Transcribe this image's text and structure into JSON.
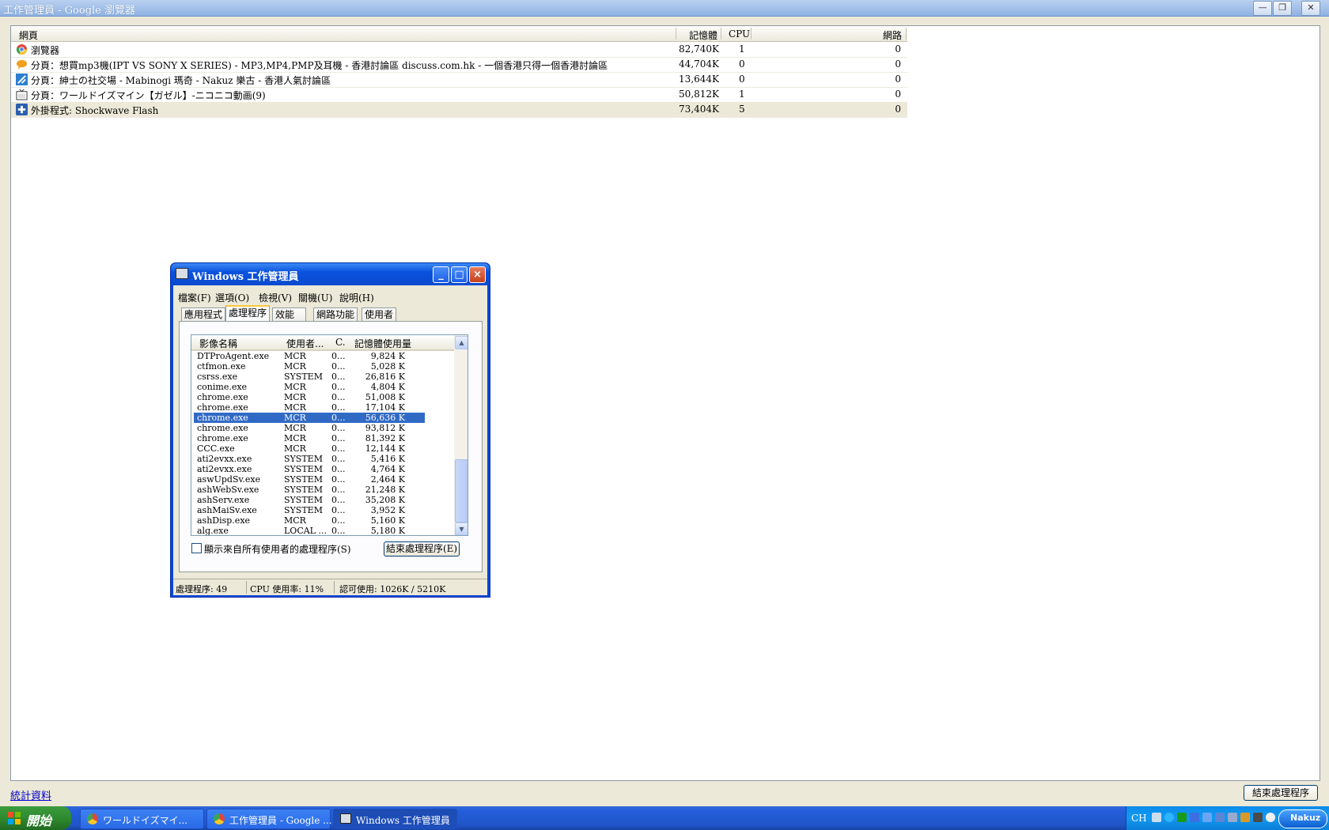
{
  "window": {
    "title": "工作管理員 - Google 瀏覽器",
    "buttons": {
      "minimize": "—",
      "restore": "❐",
      "close": "✕"
    }
  },
  "chrome_tm": {
    "columns": {
      "page": "網頁",
      "memory": "記憶體",
      "cpu": "CPU",
      "network": "網路"
    },
    "rows": [
      {
        "icon": "chrome-icon",
        "name": "瀏覽器",
        "memory": "82,740K",
        "cpu": "1",
        "network": "0"
      },
      {
        "icon": "speech-bubble-icon",
        "name": "分頁：想買mp3機(IPT VS SONY X SERIES) - MP3,MP4,PMP及耳機 - 香港討論區 discuss.com.hk - 一個香港只得一個香港討論區",
        "memory": "44,704K",
        "cpu": "0",
        "network": "0"
      },
      {
        "icon": "mabinogi-icon",
        "name": "分頁：紳士の社交場 - Mabinogi 瑪奇 - Nakuz 樂古 - 香港人氣討論區",
        "memory": "13,644K",
        "cpu": "0",
        "network": "0"
      },
      {
        "icon": "tv-icon",
        "name": "分頁：ワールドイズマイン【ガゼル】-ニコニコ動画(9)",
        "memory": "50,812K",
        "cpu": "1",
        "network": "0"
      },
      {
        "icon": "plugin-icon",
        "name": "外掛程式: Shockwave Flash",
        "memory": "73,404K",
        "cpu": "5",
        "network": "0"
      }
    ],
    "stats_link": "統計資料",
    "end_process": "結束處理程序"
  },
  "win_tm": {
    "title": "Windows 工作管理員",
    "menu": [
      "檔案(F)",
      "選項(O)",
      "檢視(V)",
      "關機(U)",
      "說明(H)"
    ],
    "tabs": [
      "應用程式",
      "處理程序",
      "效能",
      "網路功能",
      "使用者"
    ],
    "active_tab": "處理程序",
    "columns": {
      "image": "影像名稱",
      "user": "使用者...",
      "cpu": "C.",
      "mem": "記憶體使用量"
    },
    "processes": [
      {
        "name": "DTProAgent.exe",
        "user": "MCR",
        "cpu": "0...",
        "mem": "9,824 K"
      },
      {
        "name": "ctfmon.exe",
        "user": "MCR",
        "cpu": "0...",
        "mem": "5,028 K"
      },
      {
        "name": "csrss.exe",
        "user": "SYSTEM",
        "cpu": "0...",
        "mem": "26,816 K"
      },
      {
        "name": "conime.exe",
        "user": "MCR",
        "cpu": "0...",
        "mem": "4,804 K"
      },
      {
        "name": "chrome.exe",
        "user": "MCR",
        "cpu": "0...",
        "mem": "51,008 K"
      },
      {
        "name": "chrome.exe",
        "user": "MCR",
        "cpu": "0...",
        "mem": "17,104 K"
      },
      {
        "name": "chrome.exe",
        "user": "MCR",
        "cpu": "0...",
        "mem": "56,636 K",
        "selected": true
      },
      {
        "name": "chrome.exe",
        "user": "MCR",
        "cpu": "0...",
        "mem": "93,812 K"
      },
      {
        "name": "chrome.exe",
        "user": "MCR",
        "cpu": "0...",
        "mem": "81,392 K"
      },
      {
        "name": "CCC.exe",
        "user": "MCR",
        "cpu": "0...",
        "mem": "12,144 K"
      },
      {
        "name": "ati2evxx.exe",
        "user": "SYSTEM",
        "cpu": "0...",
        "mem": "5,416 K"
      },
      {
        "name": "ati2evxx.exe",
        "user": "SYSTEM",
        "cpu": "0...",
        "mem": "4,764 K"
      },
      {
        "name": "aswUpdSv.exe",
        "user": "SYSTEM",
        "cpu": "0...",
        "mem": "2,464 K"
      },
      {
        "name": "ashWebSv.exe",
        "user": "SYSTEM",
        "cpu": "0...",
        "mem": "21,248 K"
      },
      {
        "name": "ashServ.exe",
        "user": "SYSTEM",
        "cpu": "0...",
        "mem": "35,208 K"
      },
      {
        "name": "ashMaiSv.exe",
        "user": "SYSTEM",
        "cpu": "0...",
        "mem": "3,952 K"
      },
      {
        "name": "ashDisp.exe",
        "user": "MCR",
        "cpu": "0...",
        "mem": "5,160 K"
      },
      {
        "name": "alg.exe",
        "user": "LOCAL ...",
        "cpu": "0...",
        "mem": "5,180 K"
      }
    ],
    "show_all_label": "顯示來自所有使用者的處理程序(S)",
    "end_process": "結束處理程序(E)",
    "status": {
      "processes": "處理程序: 49",
      "cpu": "CPU 使用率: 11%",
      "commit": "認可使用: 1026K / 5210K"
    }
  },
  "taskbar": {
    "start": "開始",
    "tasks": [
      {
        "label": "ワールドイズマイ...",
        "icon": "chrome-icon"
      },
      {
        "label": "工作管理員 - Google ...",
        "icon": "chrome-icon"
      },
      {
        "label": "Windows 工作管理員",
        "icon": "task-manager-icon",
        "active": true
      }
    ],
    "tray": {
      "lang": "CH",
      "badge": "Nakuz"
    }
  },
  "colors": {
    "selection": "#316ac5",
    "xp_blue": "#245edb",
    "start_green": "#2f8a2f"
  }
}
